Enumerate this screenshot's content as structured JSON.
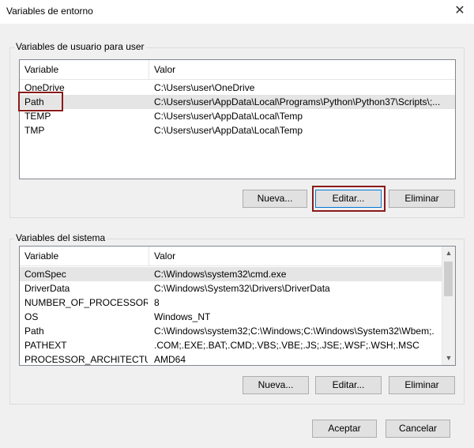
{
  "window": {
    "title": "Variables de entorno",
    "close_glyph": "✕"
  },
  "user_vars": {
    "group_label": "Variables de usuario para user",
    "columns": {
      "variable": "Variable",
      "value": "Valor"
    },
    "rows": [
      {
        "variable": "OneDrive",
        "value": "C:\\Users\\user\\OneDrive"
      },
      {
        "variable": "Path",
        "value": "C:\\Users\\user\\AppData\\Local\\Programs\\Python\\Python37\\Scripts\\;..."
      },
      {
        "variable": "TEMP",
        "value": "C:\\Users\\user\\AppData\\Local\\Temp"
      },
      {
        "variable": "TMP",
        "value": "C:\\Users\\user\\AppData\\Local\\Temp"
      }
    ],
    "selected_row": "Path",
    "buttons": {
      "new": "Nueva...",
      "edit": "Editar...",
      "delete": "Eliminar"
    }
  },
  "system_vars": {
    "group_label": "Variables del sistema",
    "columns": {
      "variable": "Variable",
      "value": "Valor"
    },
    "rows": [
      {
        "variable": "ComSpec",
        "value": "C:\\Windows\\system32\\cmd.exe"
      },
      {
        "variable": "DriverData",
        "value": "C:\\Windows\\System32\\Drivers\\DriverData"
      },
      {
        "variable": "NUMBER_OF_PROCESSORS",
        "value": "8"
      },
      {
        "variable": "OS",
        "value": "Windows_NT"
      },
      {
        "variable": "Path",
        "value": "C:\\Windows\\system32;C:\\Windows;C:\\Windows\\System32\\Wbem;..."
      },
      {
        "variable": "PATHEXT",
        "value": ".COM;.EXE;.BAT;.CMD;.VBS;.VBE;.JS;.JSE;.WSF;.WSH;.MSC"
      },
      {
        "variable": "PROCESSOR_ARCHITECTURE",
        "value": "AMD64"
      }
    ],
    "selected_row": "ComSpec",
    "buttons": {
      "new": "Nueva...",
      "edit": "Editar...",
      "delete": "Eliminar"
    }
  },
  "footer": {
    "accept": "Aceptar",
    "cancel": "Cancelar"
  },
  "colors": {
    "highlight_border": "#8b1a1a",
    "selected_row": "#e5e5e5"
  }
}
